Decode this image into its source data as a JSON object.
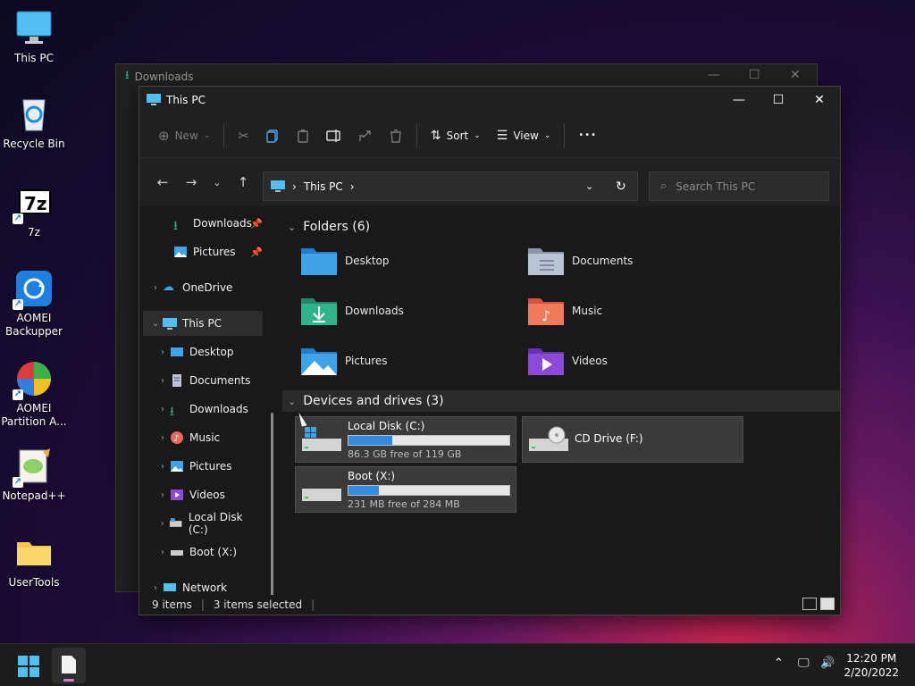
{
  "desktop": {
    "icons": [
      {
        "label": "This PC"
      },
      {
        "label": "Recycle Bin"
      },
      {
        "label": "7z"
      },
      {
        "label": "AOMEI Backupper"
      },
      {
        "label": "AOMEI Partition A..."
      },
      {
        "label": "Notepad++"
      },
      {
        "label": "UserTools"
      }
    ]
  },
  "back_window": {
    "title": "Downloads"
  },
  "window": {
    "title": "This PC",
    "toolbar": {
      "new": "New",
      "sort": "Sort",
      "view": "View",
      "more": "•••"
    },
    "address": {
      "location": "This PC"
    },
    "search": {
      "placeholder": "Search This PC"
    },
    "nav": {
      "pinned": [
        {
          "label": "Downloads"
        },
        {
          "label": "Pictures"
        }
      ],
      "onedrive": "OneDrive",
      "thispc": "This PC",
      "children": [
        {
          "label": "Desktop"
        },
        {
          "label": "Documents"
        },
        {
          "label": "Downloads"
        },
        {
          "label": "Music"
        },
        {
          "label": "Pictures"
        },
        {
          "label": "Videos"
        },
        {
          "label": "Local Disk (C:)"
        },
        {
          "label": "Boot (X:)"
        }
      ],
      "network": "Network"
    },
    "folders_header": "Folders (6)",
    "folders": [
      {
        "label": "Desktop"
      },
      {
        "label": "Documents"
      },
      {
        "label": "Downloads"
      },
      {
        "label": "Music"
      },
      {
        "label": "Pictures"
      },
      {
        "label": "Videos"
      }
    ],
    "drives_header": "Devices and drives (3)",
    "drives": [
      {
        "name": "Local Disk (C:)",
        "free": "86.3 GB free of 119 GB",
        "used_fraction": 0.27
      },
      {
        "name": "CD Drive (F:)"
      },
      {
        "name": "Boot (X:)",
        "free": "231 MB free of 284 MB",
        "used_fraction": 0.19
      }
    ],
    "status": {
      "items": "9 items",
      "selected": "3 items selected"
    }
  },
  "taskbar": {
    "time": "12:20 PM",
    "date": "2/20/2022"
  },
  "colors": {
    "accent": "#2e8be0",
    "folder_blue": "#3fa3e8",
    "folder_green": "#2fb38a"
  }
}
